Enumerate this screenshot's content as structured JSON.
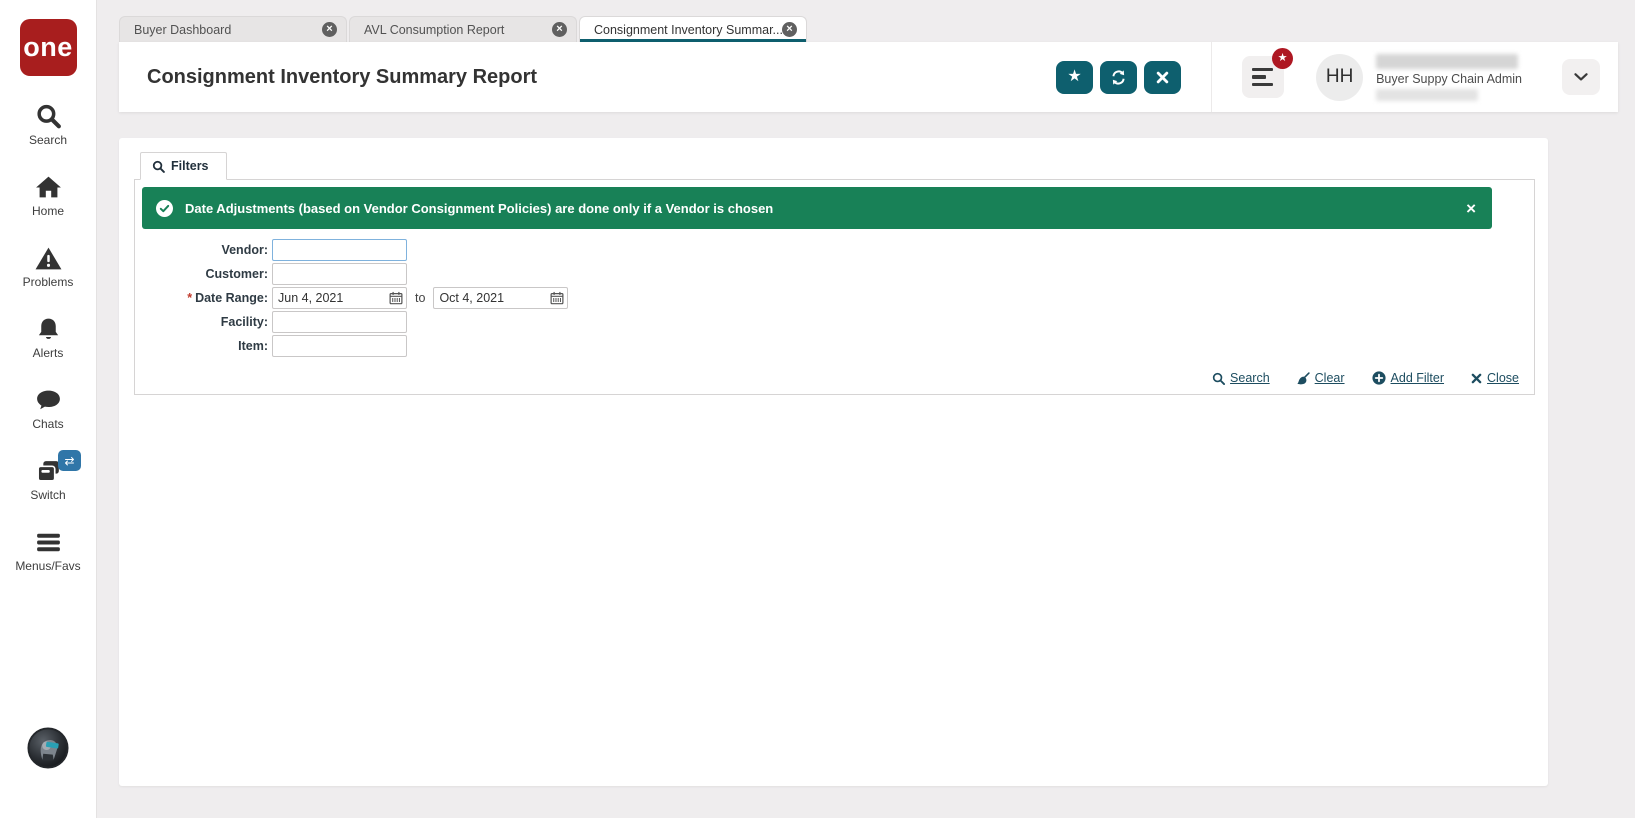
{
  "logo": {
    "text": "one"
  },
  "icons": {
    "star": "★",
    "close": "×",
    "switch_arrows": "⇄"
  },
  "colors": {
    "accent_teal": "#0e5f6e",
    "banner_green": "#188157",
    "logo_red": "#a81e1e",
    "badge_red": "#ae1722",
    "switch_badge_blue": "#3076a8",
    "link_color": "#1d4d60",
    "focus_border_blue": "#7fb2dd"
  },
  "sidebar": {
    "items": [
      {
        "label": "Search"
      },
      {
        "label": "Home"
      },
      {
        "label": "Problems"
      },
      {
        "label": "Alerts"
      },
      {
        "label": "Chats"
      },
      {
        "label": "Switch"
      },
      {
        "label": "Menus/Favs"
      }
    ]
  },
  "tabs": [
    {
      "label": "Buyer Dashboard",
      "active": false
    },
    {
      "label": "AVL Consumption Report",
      "active": false
    },
    {
      "label": "Consignment Inventory Summar...",
      "active": true
    }
  ],
  "header": {
    "title": "Consignment Inventory Summary Report",
    "user": {
      "initials": "HH",
      "role": "Buyer Suppy Chain Admin"
    }
  },
  "filters": {
    "tab_label": "Filters",
    "banner": {
      "text": "Date Adjustments (based on Vendor Consignment Policies) are done only if a Vendor is chosen"
    },
    "required_marker": "*",
    "labels": {
      "vendor": "Vendor:",
      "customer": "Customer:",
      "date_range": "Date Range:",
      "facility": "Facility:",
      "item": "Item:"
    },
    "date": {
      "from": "Jun 4, 2021",
      "to_word": "to",
      "to": "Oct 4, 2021"
    },
    "links": {
      "search": "Search",
      "clear": "Clear",
      "add_filter": "Add Filter",
      "close": "Close"
    }
  }
}
